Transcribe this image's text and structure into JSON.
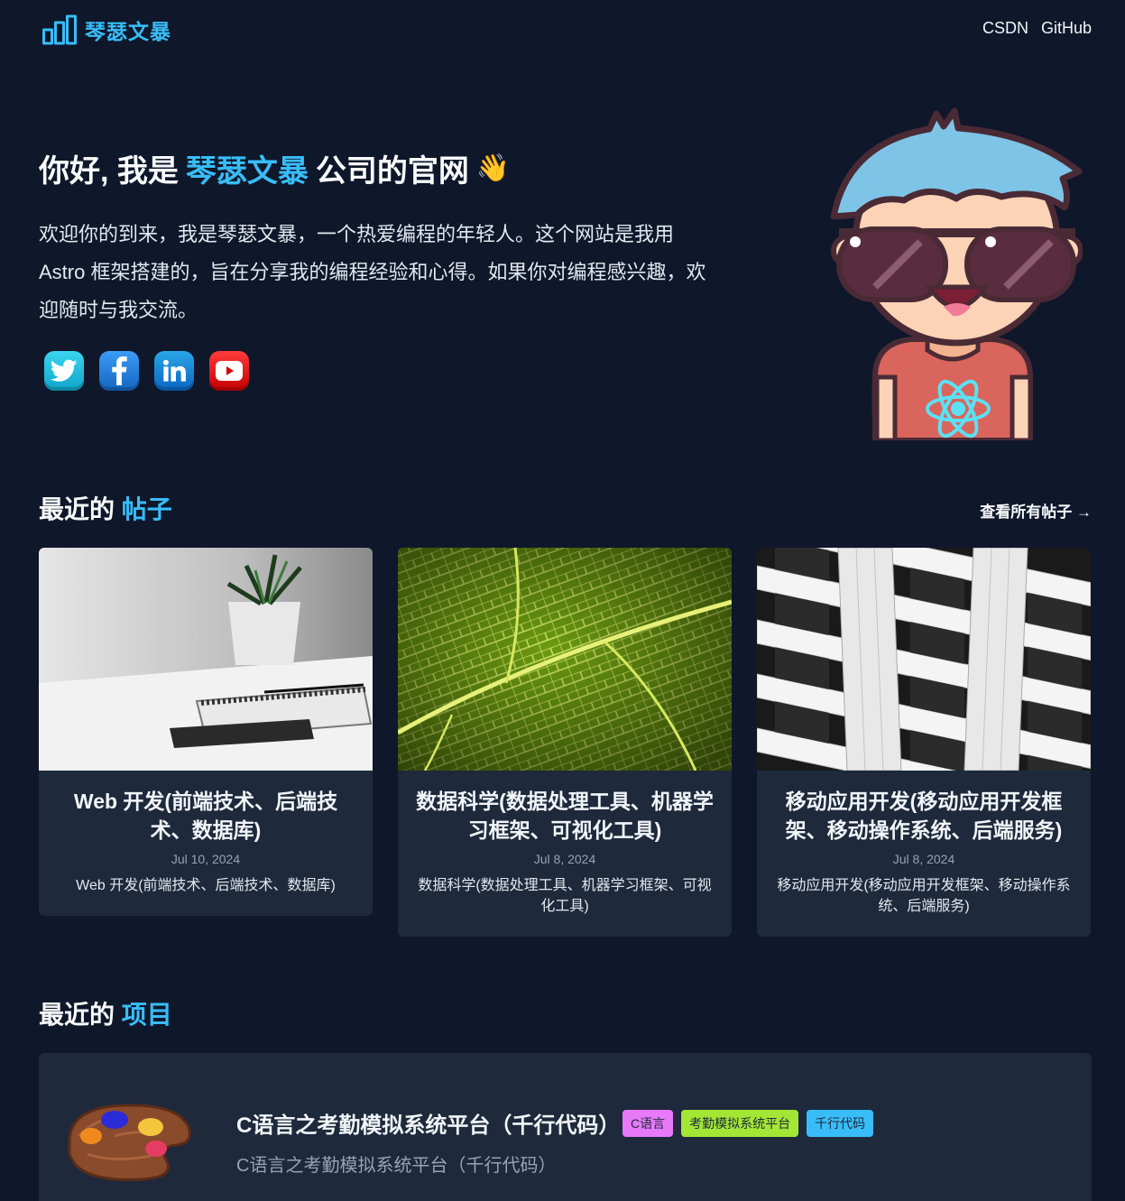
{
  "header": {
    "logo_text": "琴瑟文暴",
    "nav": [
      "CSDN",
      "GitHub"
    ]
  },
  "hero": {
    "greeting_prefix": "你好, 我是",
    "greeting_name": "琴瑟文暴",
    "greeting_suffix": "公司的官网",
    "wave_emoji": "👋",
    "intro": "欢迎你的到来，我是琴瑟文暴，一个热爱编程的年轻人。这个网站是我用 Astro 框架搭建的，旨在分享我的编程经验和心得。如果你对编程感兴趣，欢迎随时与我交流。",
    "socials": [
      "twitter-icon",
      "facebook-icon",
      "linkedin-icon",
      "youtube-icon"
    ]
  },
  "posts_section": {
    "title_prefix": "最近的",
    "title_accent": "帖子",
    "view_all": "查看所有帖子 →"
  },
  "posts": [
    {
      "title": "Web 开发(前端技术、后端技术、数据库)",
      "date": "Jul 10, 2024",
      "desc": "Web 开发(前端技术、后端技术、数据库)"
    },
    {
      "title": "数据科学(数据处理工具、机器学习框架、可视化工具)",
      "date": "Jul 8, 2024",
      "desc": "数据科学(数据处理工具、机器学习框架、可视化工具)"
    },
    {
      "title": "移动应用开发(移动应用开发框架、移动操作系统、后端服务)",
      "date": "Jul 8, 2024",
      "desc": "移动应用开发(移动应用开发框架、移动操作系统、后端服务)"
    }
  ],
  "projects_section": {
    "title_prefix": "最近的",
    "title_accent": "项目"
  },
  "project": {
    "title": "C语言之考勤模拟系统平台（千行代码）",
    "desc": "C语言之考勤模拟系统平台（千行代码）",
    "tags": [
      {
        "label": "C语言",
        "color": "#e879f9"
      },
      {
        "label": "考勤模拟系统平台",
        "color": "#a3e635"
      },
      {
        "label": "千行代码",
        "color": "#38bdf8"
      }
    ]
  },
  "colors": {
    "background": "#0f172a",
    "card": "#1e293b",
    "accent": "#38bdf8"
  }
}
